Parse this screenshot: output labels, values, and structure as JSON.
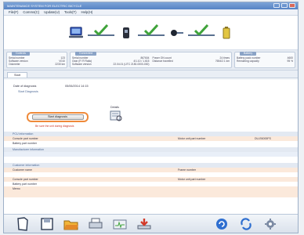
{
  "window": {
    "title": "MAINTENANCE SYSTEM FOR ELECTRIC BICYCLE"
  },
  "menu": [
    "File(F)",
    "Comms(C)",
    "Update(U)",
    "Tools(T)",
    "Help(H)"
  ],
  "steps": [
    "pc-icon",
    "check-icon",
    "controller-icon",
    "check-icon",
    "connector-icon",
    "check-icon",
    "battery-icon"
  ],
  "panels": {
    "controls": {
      "caption": "Controls",
      "rows": [
        [
          "Serial number",
          "123"
        ],
        [
          "Software version",
          "V010"
        ],
        [
          "Odometer",
          "2230 km"
        ]
      ]
    },
    "connected": {
      "caption": "Connected",
      "left": [
        [
          "Serial number",
          "867604"
        ],
        [
          "Gear (F/ R Ratio)",
          "4/1.10 / 1.615"
        ],
        [
          "Software version",
          "22.04.01 (UTC 2150-0000-000)"
        ]
      ],
      "right": [
        [
          "Power ON count",
          "24 times"
        ],
        [
          "Distance travelled",
          "7654/2.1 km"
        ],
        [
          "",
          ""
        ]
      ]
    },
    "battery": {
      "caption": "Battery",
      "rows": [
        [
          "Battery pack number",
          "4600"
        ],
        [
          "Remaining capacity",
          "95 %"
        ]
      ]
    }
  },
  "tabs": [
    "Start"
  ],
  "diagnosis": {
    "date_label": "Date of diagnosis",
    "date_value": "05/06/2014 14:15",
    "subtitle": "Start Diagnosis",
    "start_button": "Start diagnosis",
    "warning": "Be sure the unit during diagnosis",
    "details_label": "Details"
  },
  "sections": {
    "pc_info": {
      "title": "PCU information",
      "rows": [
        {
          "label": "Console part number",
          "rlabel": "Motor unit part number",
          "rvalue": "DU-E6000FS"
        },
        {
          "label": "Battery part number",
          "rlabel": "",
          "rvalue": ""
        }
      ]
    },
    "manufacturer": {
      "title": "Manufacturer information"
    },
    "customer": {
      "title": "Customer information",
      "rows": [
        {
          "label": "Customer name",
          "rlabel": "Frame number",
          "rvalue": ""
        },
        {
          "label": "",
          "rlabel": "",
          "rvalue": ""
        },
        {
          "label": "Console part number",
          "rlabel": "Motor unit part number",
          "rvalue": ""
        },
        {
          "label": "Battery part number",
          "rlabel": "",
          "rvalue": ""
        },
        {
          "label": "Memo",
          "rlabel": "",
          "rvalue": ""
        }
      ]
    }
  },
  "toolbar": [
    "new-icon",
    "save-icon",
    "open-folder-icon",
    "print-icon",
    "diagnose-icon",
    "export-icon",
    "refresh-icon",
    "sync-icon",
    "settings-icon"
  ]
}
